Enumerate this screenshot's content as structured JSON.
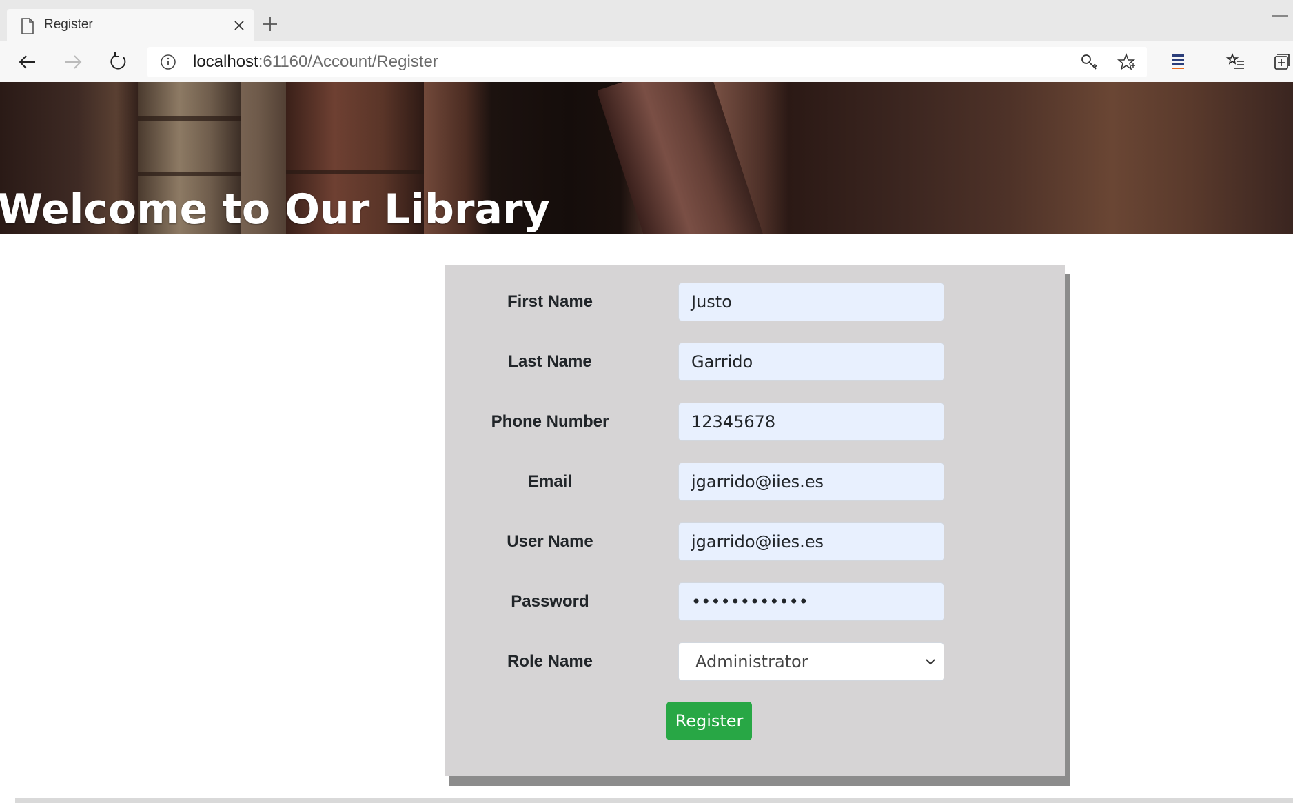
{
  "browser": {
    "tab_title": "Register",
    "url_host": "localhost",
    "url_rest": ":61160/Account/Register"
  },
  "banner": {
    "title": "Welcome to Our Library"
  },
  "form": {
    "fields": [
      {
        "label": "First Name",
        "value": "Justo"
      },
      {
        "label": "Last Name",
        "value": "Garrido"
      },
      {
        "label": "Phone Number",
        "value": "12345678"
      },
      {
        "label": "Email",
        "value": "jgarrido@iies.es"
      },
      {
        "label": "User Name",
        "value": "jgarrido@iies.es"
      },
      {
        "label": "Password",
        "value": "••••••••••••"
      }
    ],
    "role": {
      "label": "Role Name",
      "selected": "Administrator"
    },
    "submit_label": "Register"
  },
  "colors": {
    "panel_bg": "#d6d4d5",
    "input_bg": "#e8f0fe",
    "button_bg": "#28a745"
  }
}
